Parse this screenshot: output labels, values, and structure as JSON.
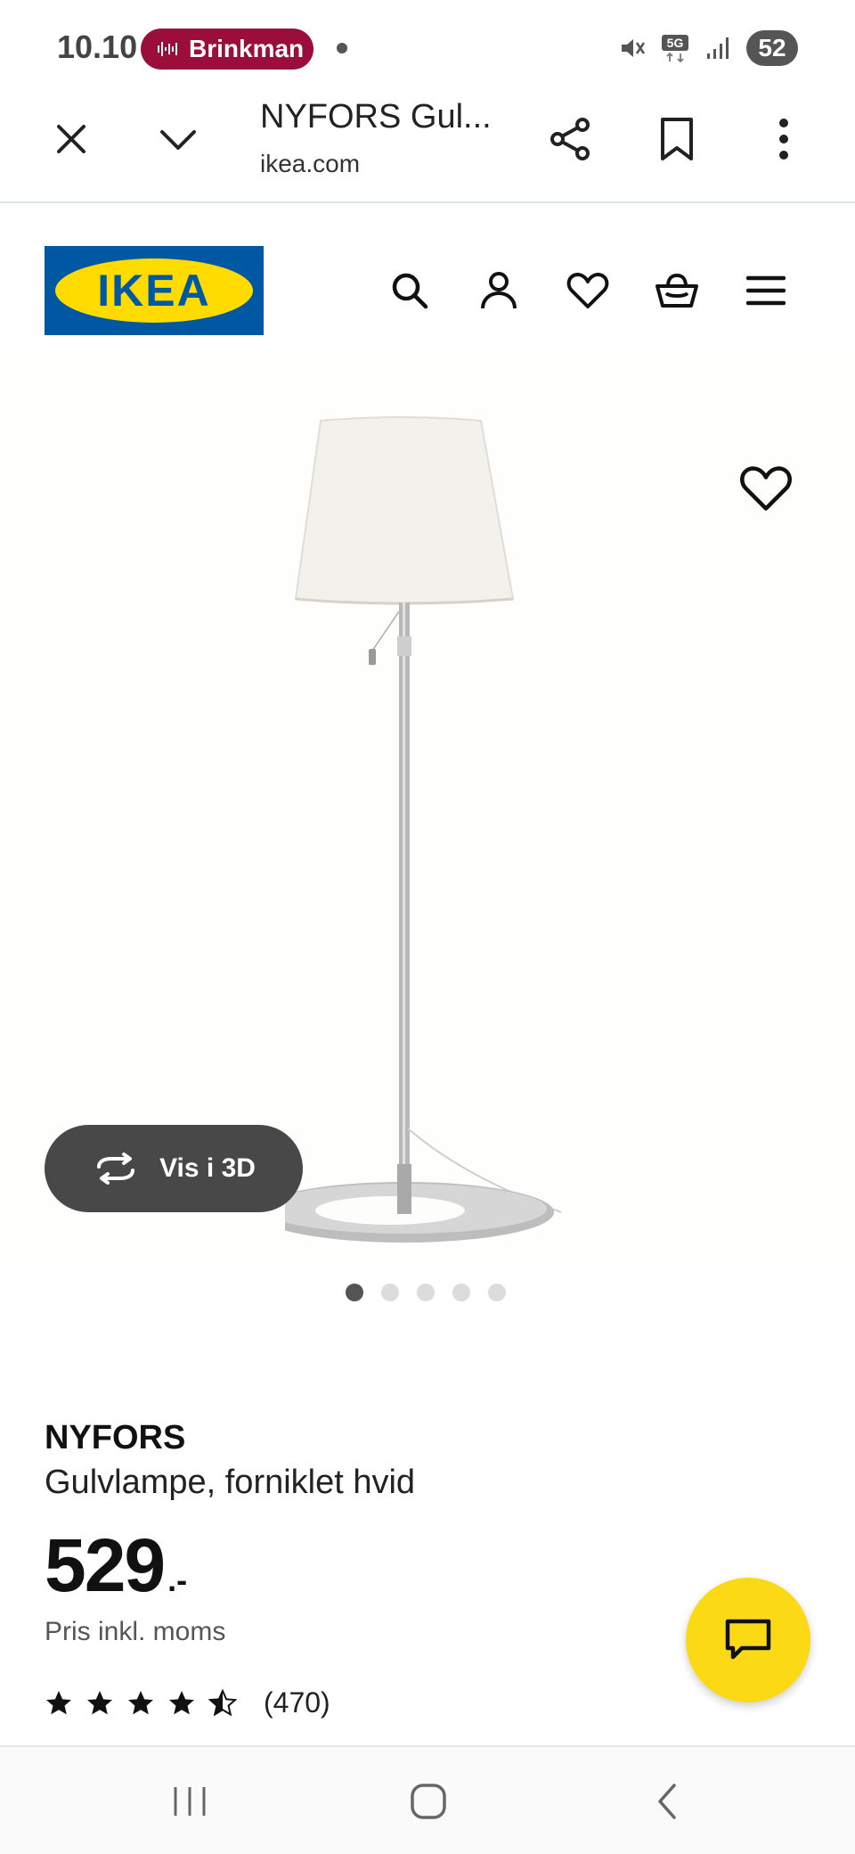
{
  "status_bar": {
    "time": "10.10",
    "media_app": "Brinkman",
    "battery": "52",
    "accent": "#9b0d3a"
  },
  "browser": {
    "tab_title": "NYFORS Gul...",
    "url": "ikea.com",
    "icons": [
      "close-icon",
      "chevron-down-icon",
      "share-icon",
      "bookmark-icon",
      "more-vert-icon"
    ]
  },
  "site_header": {
    "logo_text": "IKEA",
    "icons": [
      "search-icon",
      "account-icon",
      "heart-icon",
      "basket-icon",
      "menu-icon"
    ],
    "brand_blue": "#0058a3",
    "brand_yellow": "#ffdb00"
  },
  "gallery": {
    "view_3d_label": "Vis i 3D",
    "slide_count": 5,
    "active_slide": 1
  },
  "product": {
    "name": "NYFORS",
    "description": "Gulvlampe, forniklet hvid",
    "price": "529",
    "price_suffix": ".-",
    "vat_note": "Pris inkl. moms",
    "rating": 4.5,
    "rating_max": 5,
    "review_count": "(470)"
  },
  "chat": {
    "fab_color": "#fbd914"
  },
  "nav_bar": {
    "buttons": [
      "recents-icon",
      "home-icon",
      "back-icon"
    ]
  }
}
